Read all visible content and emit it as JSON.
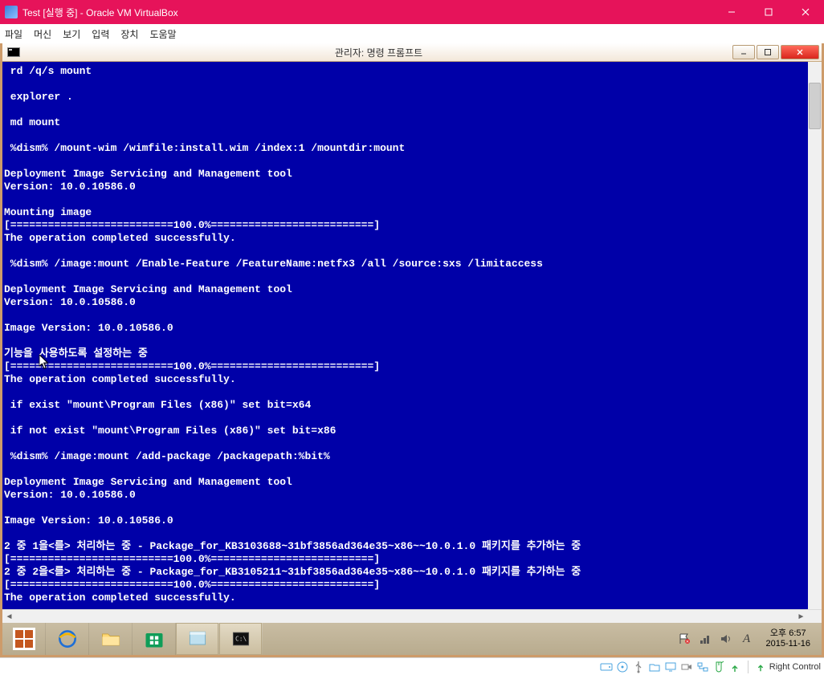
{
  "window": {
    "title": "Test [실행 중] - Oracle VM VirtualBox"
  },
  "menubar": {
    "items": [
      "파일",
      "머신",
      "보기",
      "입력",
      "장치",
      "도움말"
    ]
  },
  "inner": {
    "title": "관리자: 명령 프롬프트"
  },
  "terminal": {
    "text": " rd /q/s mount\n\n explorer .\n\n md mount\n\n %dism% /mount-wim /wimfile:install.wim /index:1 /mountdir:mount\n\nDeployment Image Servicing and Management tool\nVersion: 10.0.10586.0\n\nMounting image\n[==========================100.0%==========================]\nThe operation completed successfully.\n\n %dism% /image:mount /Enable-Feature /FeatureName:netfx3 /all /source:sxs /limitaccess\n\nDeployment Image Servicing and Management tool\nVersion: 10.0.10586.0\n\nImage Version: 10.0.10586.0\n\n기능을 사용하도록 설정하는 중\n[==========================100.0%==========================]\nThe operation completed successfully.\n\n if exist \"mount\\Program Files (x86)\" set bit=x64\n\n if not exist \"mount\\Program Files (x86)\" set bit=x86\n\n %dism% /image:mount /add-package /packagepath:%bit%\n\nDeployment Image Servicing and Management tool\nVersion: 10.0.10586.0\n\nImage Version: 10.0.10586.0\n\n2 중 1을<를> 처리하는 중 - Package_for_KB3103688~31bf3856ad364e35~x86~~10.0.1.0 패키지를 추가하는 중\n[==========================100.0%==========================]\n2 중 2을<를> 처리하는 중 - Package_for_KB3105211~31bf3856ad364e35~x86~~10.0.1.0 패키지를 추가하는 중\n[==========================100.0%==========================]\nThe operation completed successfully."
  },
  "tray": {
    "time": "오후 6:57",
    "date": "2015-11-16",
    "ime": "A"
  },
  "statusbar": {
    "hostkey": "Right Control"
  }
}
